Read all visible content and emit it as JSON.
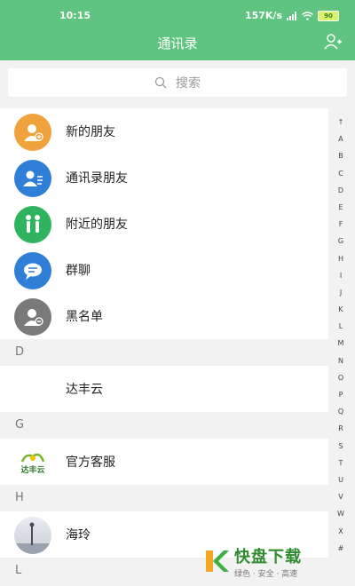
{
  "status_bar": {
    "time": "10:15",
    "net_speed": "157K/s",
    "battery": "90"
  },
  "header": {
    "title": "通讯录"
  },
  "search": {
    "placeholder": "搜索"
  },
  "functions": [
    {
      "label": "新的朋友",
      "color": "#f0a33c",
      "icon": "new-friend-icon"
    },
    {
      "label": "通讯录朋友",
      "color": "#2f7fd6",
      "icon": "contact-card-icon"
    },
    {
      "label": "附近的朋友",
      "color": "#2fb35e",
      "icon": "nearby-people-icon"
    },
    {
      "label": "群聊",
      "color": "#2f7fd6",
      "icon": "group-chat-icon"
    },
    {
      "label": "黑名单",
      "color": "#7a7a7a",
      "icon": "blacklist-icon"
    }
  ],
  "sections": [
    {
      "letter": "D",
      "contacts": [
        {
          "name": "达丰云"
        }
      ]
    },
    {
      "letter": "G",
      "contacts": [
        {
          "name": "官方客服",
          "logo_text": "达丰云"
        }
      ]
    },
    {
      "letter": "H",
      "contacts": [
        {
          "name": "海玲"
        }
      ]
    },
    {
      "letter": "L",
      "contacts": []
    }
  ],
  "index_letters": [
    "↑",
    "A",
    "B",
    "C",
    "D",
    "E",
    "F",
    "G",
    "H",
    "I",
    "J",
    "K",
    "L",
    "M",
    "N",
    "O",
    "P",
    "Q",
    "R",
    "S",
    "T",
    "U",
    "V",
    "W",
    "X",
    "#"
  ],
  "watermark": {
    "brand": "快盘下载",
    "slogan": "绿色 · 安全 · 高速"
  }
}
